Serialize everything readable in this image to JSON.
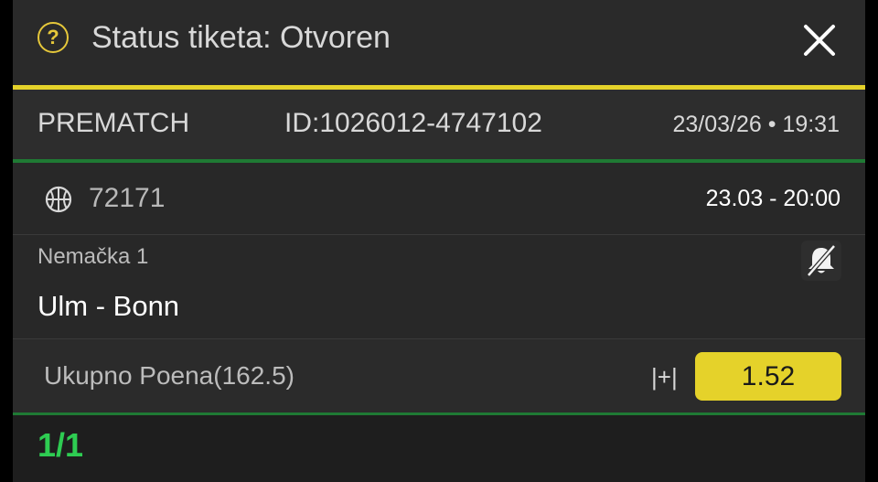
{
  "header": {
    "title": "Status tiketa: Otvoren",
    "help_icon": "?"
  },
  "info": {
    "type": "PREMATCH",
    "ticket_id": "ID:1026012-4747102",
    "datetime": "23/03/26 • 19:31"
  },
  "match": {
    "sport_icon": "basketball-icon",
    "code": "72171",
    "time": "23.03  -  20:00",
    "league": "Nemačka 1",
    "teams": "Ulm - Bonn",
    "notification_icon": "bell-off-icon"
  },
  "bet": {
    "market": "Ukupno Poena(162.5)",
    "pick": "|+|",
    "odds": "1.52"
  },
  "footer": {
    "count": "1/1"
  },
  "colors": {
    "accent_yellow": "#e5d22a",
    "accent_green": "#2ecc52",
    "divider_green": "#1f7a34"
  }
}
